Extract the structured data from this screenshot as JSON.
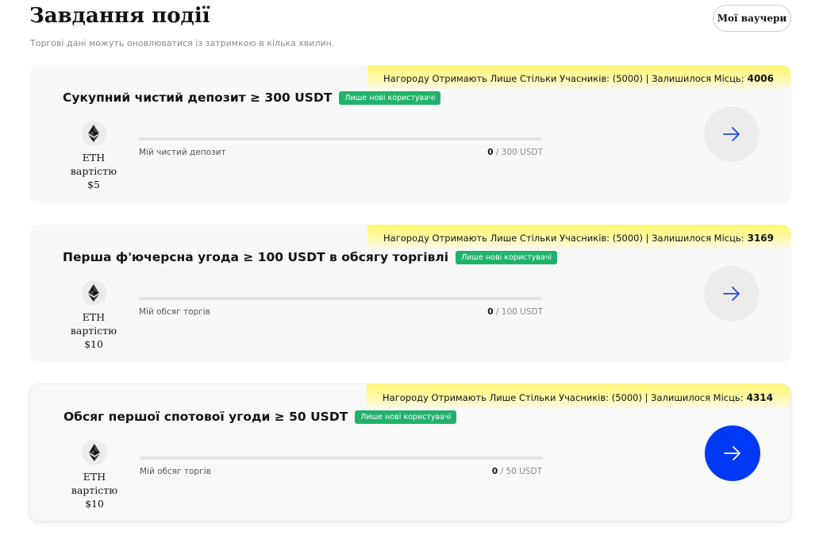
{
  "header": {
    "title": "Завдання події",
    "subtitle": "Торгові дані можуть оновлюватися із затримкою в кілька хвилин.",
    "vouchers_label": "Мої ваучери"
  },
  "colors": {
    "accent_blue": "#0039f5",
    "badge_green": "#20b26c",
    "banner_yellow": "#fff670"
  },
  "tasks": [
    {
      "reward_text": "Нагороду Отримають Лише Стільки Учасників: (5000) | Залишилося Місць:",
      "remaining": "4006",
      "title": "Сукупний чистий депозит ≥ 300 USDT",
      "badge": "Лише нові користувачі",
      "coin_icon": "eth-icon",
      "coin_line1": "ETH",
      "coin_line2": "вартістю",
      "coin_line3": "$5",
      "progress_label": "Мій чистий депозит",
      "progress_current": "0",
      "progress_target": " / 300 USDT",
      "progress_fraction": 0,
      "button_icon": "arrow-right-icon"
    },
    {
      "reward_text": "Нагороду Отримають Лише Стільки Учасників: (5000) | Залишилося Місць:",
      "remaining": "3169",
      "title": "Перша ф'ючерсна угода ≥ 100 USDT в обсягу торгівлі",
      "badge": "Лише нові користувачі",
      "coin_icon": "eth-icon",
      "coin_line1": "ETH",
      "coin_line2": "вартістю",
      "coin_line3": "$10",
      "progress_label": "Мій обсяг торгів",
      "progress_current": "0",
      "progress_target": " / 100 USDT",
      "progress_fraction": 0,
      "button_icon": "arrow-right-icon"
    },
    {
      "reward_text": "Нагороду Отримають Лише Стільки Учасників: (5000) | Залишилося Місць:",
      "remaining": "4314",
      "title": "Обсяг першої спотової угоди ≥ 50 USDT",
      "badge": "Лише нові користувачі",
      "coin_icon": "eth-icon",
      "coin_line1": "ETH",
      "coin_line2": "вартістю",
      "coin_line3": "$10",
      "progress_label": "Мій обсяг торгів",
      "progress_current": "0",
      "progress_target": " / 50 USDT",
      "progress_fraction": 0,
      "button_icon": "arrow-right-icon"
    }
  ]
}
